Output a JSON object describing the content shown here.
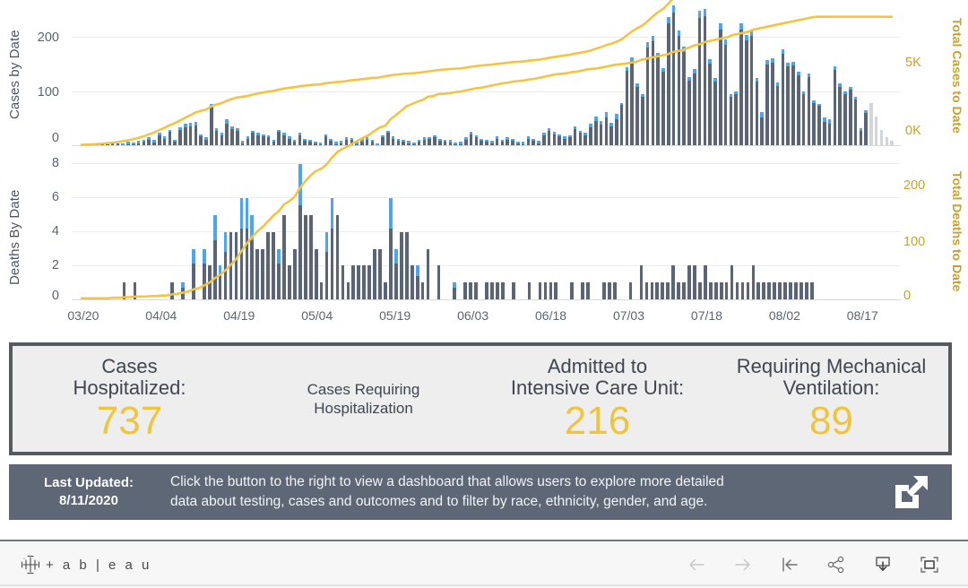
{
  "chart_data": [
    {
      "type": "bar",
      "id": "cases-chart",
      "title": "",
      "ylabel": "Cases by Date",
      "y2label": "Total Cases to Date",
      "xlabel": "",
      "ylim": [
        0,
        260
      ],
      "yticks": [
        0,
        100,
        200
      ],
      "y2lim": [
        0,
        6500
      ],
      "y2ticks": [
        "0K",
        "5K"
      ],
      "grid": true,
      "legend": "none",
      "colors": {
        "bar": "#5a6577",
        "bar_cap": "#4ca5f2",
        "bar_preliminary": "#d4d6d8",
        "cumulative_line": "#f5c344"
      },
      "x_tick_labels": [
        "03/20",
        "04/04",
        "04/19",
        "05/04",
        "05/19",
        "06/03",
        "06/18",
        "07/03",
        "07/18",
        "08/02",
        "08/17"
      ],
      "series": [
        {
          "name": "Cases by Date",
          "values": [
            0,
            0,
            1,
            1,
            2,
            2,
            3,
            3,
            4,
            6,
            5,
            8,
            10,
            14,
            9,
            22,
            16,
            28,
            10,
            32,
            38,
            40,
            42,
            20,
            14,
            74,
            30,
            22,
            46,
            34,
            30,
            8,
            16,
            26,
            22,
            20,
            18,
            10,
            28,
            22,
            16,
            10,
            22,
            12,
            10,
            7,
            5,
            20,
            12,
            6,
            8,
            14,
            13,
            6,
            11,
            14,
            10,
            4,
            18,
            26,
            16,
            12,
            10,
            8,
            5,
            10,
            14,
            15,
            18,
            12,
            10,
            9,
            5,
            6,
            14,
            24,
            18,
            12,
            10,
            8,
            16,
            10,
            14,
            12,
            7,
            6,
            16,
            12,
            8,
            22,
            30,
            24,
            20,
            16,
            18,
            34,
            26,
            22,
            38,
            52,
            44,
            60,
            40,
            56,
            76,
            140,
            158,
            110,
            92,
            184,
            196,
            166,
            138,
            230,
            250,
            206,
            176,
            122,
            136,
            240,
            244,
            154,
            120,
            218,
            190,
            92,
            96,
            218,
            198,
            206,
            120,
            60,
            152,
            156,
            112,
            172,
            148,
            150,
            132,
            96,
            128,
            80,
            74,
            50,
            46,
            142,
            110,
            96,
            104,
            86,
            30,
            62,
            76,
            52,
            28,
            14,
            8
          ]
        },
        {
          "name": "Cumulative Total Cases",
          "type": "line",
          "values": [
            20,
            30,
            40,
            55,
            70,
            90,
            115,
            145,
            180,
            225,
            270,
            330,
            400,
            490,
            570,
            680,
            780,
            900,
            990,
            1110,
            1230,
            1350,
            1470,
            1540,
            1600,
            1740,
            1820,
            1890,
            1990,
            2070,
            2140,
            2170,
            2210,
            2270,
            2320,
            2365,
            2405,
            2430,
            2490,
            2535,
            2570,
            2595,
            2640,
            2665,
            2690,
            2710,
            2725,
            2770,
            2800,
            2820,
            2840,
            2875,
            2905,
            2925,
            2955,
            2985,
            3010,
            3025,
            3065,
            3110,
            3145,
            3170,
            3195,
            3210,
            3225,
            3250,
            3280,
            3310,
            3345,
            3370,
            3390,
            3410,
            3425,
            3440,
            3470,
            3510,
            3545,
            3570,
            3590,
            3610,
            3640,
            3665,
            3695,
            3720,
            3735,
            3750,
            3780,
            3805,
            3825,
            3865,
            3910,
            3950,
            3985,
            4015,
            4050,
            4100,
            4140,
            4180,
            4240,
            4320,
            4390,
            4480,
            4545,
            4630,
            4740,
            4920,
            5100,
            5240,
            5360,
            5560,
            5770,
            5960,
            6110,
            6350,
            6600,
            6820,
            7010,
            7150,
            7300,
            7550,
            7800,
            7970,
            8110,
            8340,
            8550,
            8660,
            8770,
            9000,
            9210,
            9420,
            9550,
            9620,
            9780,
            9940,
            10060,
            10240,
            10400,
            10560,
            10700,
            10810,
            10950,
            11040,
            11120,
            11180,
            11230,
            11380,
            11500,
            11600,
            11710,
            11800,
            11840,
            11910,
            11990,
            12050,
            12080,
            12100,
            12110
          ]
        }
      ]
    },
    {
      "type": "bar",
      "id": "deaths-chart",
      "title": "",
      "ylabel": "Deaths By Date",
      "y2label": "Total Deaths to Date",
      "xlabel": "",
      "ylim": [
        0,
        8.6
      ],
      "yticks": [
        0,
        2,
        4,
        6,
        8
      ],
      "y2lim": [
        0,
        260
      ],
      "y2ticks": [
        0,
        100,
        200
      ],
      "grid": true,
      "legend": "none",
      "colors": {
        "bar": "#5a6577",
        "bar_cap": "#4ca5f2",
        "cumulative_line": "#f5c344"
      },
      "x_tick_labels": [
        "03/20",
        "04/04",
        "04/19",
        "05/04",
        "05/19",
        "06/03",
        "06/18",
        "07/03",
        "07/18",
        "08/02",
        "08/17"
      ],
      "series": [
        {
          "name": "Deaths By Date",
          "values": [
            0,
            0,
            0,
            0,
            0,
            0,
            0,
            0,
            1,
            0,
            1,
            0,
            0,
            0,
            0,
            0,
            0,
            1,
            0,
            1,
            0,
            3,
            0,
            3,
            2,
            5,
            2,
            4,
            4,
            4,
            6,
            6,
            5,
            3,
            3,
            4,
            4,
            3,
            5,
            2,
            3,
            8,
            5,
            5,
            3,
            1,
            4,
            6,
            5,
            2,
            1,
            2,
            2,
            2,
            2,
            3,
            3,
            1,
            6,
            3,
            4,
            4,
            2,
            2,
            1,
            3,
            0,
            2,
            0,
            0,
            1,
            0,
            1,
            1,
            1,
            0,
            1,
            1,
            1,
            1,
            0,
            1,
            0,
            0,
            1,
            0,
            1,
            1,
            1,
            1,
            0,
            0,
            1,
            0,
            1,
            1,
            0,
            0,
            1,
            1,
            1,
            0,
            0,
            1,
            0,
            2,
            1,
            1,
            1,
            1,
            1,
            2,
            1,
            1,
            2,
            2,
            1,
            2,
            1,
            1,
            1,
            1,
            2,
            1,
            1,
            1,
            2,
            1,
            1,
            1,
            1,
            1,
            1,
            1,
            1,
            1,
            1,
            1,
            0,
            0,
            0,
            0,
            0,
            0,
            0,
            0,
            0,
            0,
            0,
            0,
            0,
            0,
            0
          ]
        },
        {
          "name": "Cumulative Total Deaths",
          "type": "line",
          "values": [
            2,
            2,
            2,
            2,
            2,
            2,
            3,
            3,
            4,
            4,
            5,
            5,
            5,
            6,
            6,
            7,
            7,
            9,
            10,
            12,
            14,
            18,
            20,
            25,
            30,
            38,
            44,
            52,
            62,
            72,
            86,
            100,
            112,
            122,
            130,
            140,
            150,
            158,
            170,
            176,
            184,
            200,
            212,
            222,
            230,
            234,
            242,
            254,
            264,
            270,
            274,
            280,
            285,
            290,
            295,
            302,
            308,
            311,
            323,
            330,
            338,
            346,
            350,
            354,
            357,
            363,
            364,
            368,
            368,
            369,
            371,
            372,
            374,
            376,
            378,
            379,
            381,
            383,
            385,
            387,
            388,
            390,
            391,
            392,
            394,
            395,
            397,
            399,
            401,
            403,
            404,
            405,
            407,
            408,
            410,
            412,
            413,
            414,
            416,
            418,
            420,
            421,
            422,
            424,
            425,
            429,
            431,
            433,
            435,
            437,
            439,
            443,
            445,
            447,
            451,
            455,
            457,
            461,
            463,
            465,
            467,
            469,
            473,
            475,
            477,
            479,
            483,
            485,
            487,
            489,
            491,
            493,
            495,
            497,
            499,
            501,
            503,
            505,
            506,
            506,
            506,
            506,
            506,
            506,
            506,
            506,
            506,
            506,
            506,
            506,
            506,
            506,
            506
          ]
        }
      ]
    }
  ],
  "charts": {
    "cases": {
      "y_axis_title": "Cases by Date",
      "y2_axis_title": "Total Cases to Date",
      "yticks": [
        "200",
        "100",
        "0"
      ],
      "y2ticks": [
        "5K",
        "0K"
      ]
    },
    "deaths": {
      "y_axis_title": "Deaths By Date",
      "y2_axis_title": "Total Deaths to Date",
      "yticks": [
        "8",
        "6",
        "4",
        "2",
        "0"
      ],
      "y2ticks": [
        "200",
        "100",
        "0"
      ]
    },
    "x_ticks": [
      "03/20",
      "04/04",
      "04/19",
      "05/04",
      "05/19",
      "06/03",
      "06/18",
      "07/03",
      "07/18",
      "08/02",
      "08/17"
    ]
  },
  "stats": [
    {
      "label_line1": "Cases",
      "label_line2": "Hospitalized:",
      "value": "737",
      "kind": "metric"
    },
    {
      "label_line1": "Cases Requiring",
      "label_line2": "Hospitalization",
      "value": "",
      "kind": "caption"
    },
    {
      "label_line1": "Admitted to",
      "label_line2": "Intensive Care Unit:",
      "value": "216",
      "kind": "metric"
    },
    {
      "label_line1": "Requiring Mechanical",
      "label_line2": "Ventilation:",
      "value": "89",
      "kind": "metric"
    }
  ],
  "note": {
    "updated_label": "Last Updated:",
    "updated_date": "8/11/2020",
    "message_line1": "Click the button to the right to view a dashboard that allows users to explore more detailed",
    "message_line2": "data about testing, cases and outcomes and to filter by race, ethnicity, gender, and age.",
    "link_icon": "external-link-icon"
  },
  "footer": {
    "brand": "+ a b | e a u",
    "logo_icon": "tableau-logo-icon",
    "tools": [
      {
        "name": "back-button",
        "icon": "arrow-left-icon"
      },
      {
        "name": "forward-button",
        "icon": "arrow-right-icon"
      },
      {
        "name": "revert-button",
        "icon": "revert-to-start-icon"
      },
      {
        "name": "share-button",
        "icon": "share-icon"
      },
      {
        "name": "download-button",
        "icon": "download-icon"
      },
      {
        "name": "fullscreen-button",
        "icon": "fullscreen-icon"
      }
    ]
  },
  "colors": {
    "bar": "#5a6577",
    "bar_cap": "#4ca5f2",
    "bar_preliminary": "#d4d6d8",
    "accent_gold": "#f5c344",
    "value_gold": "#eec53c",
    "panel_border": "#555a5e",
    "panel_fill": "#eeeeee",
    "note_bg": "#5d6775"
  }
}
